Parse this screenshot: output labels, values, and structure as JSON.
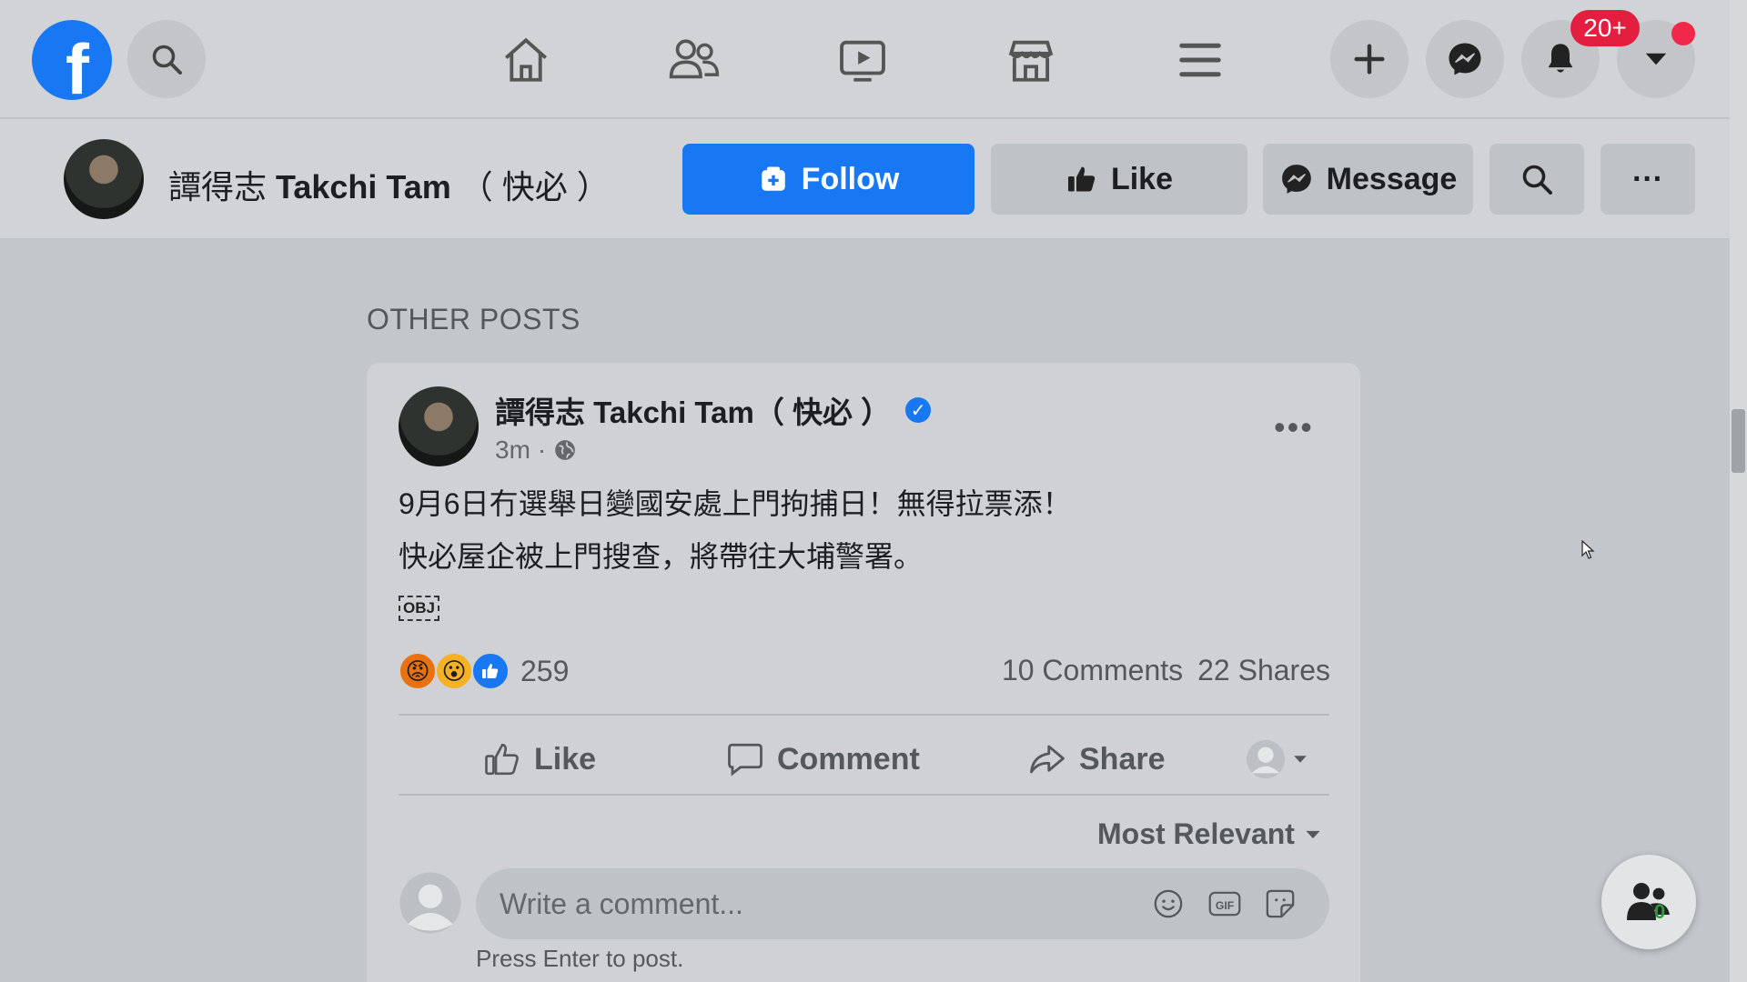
{
  "topnav": {
    "logo_letter": "f",
    "notification_badge": "20+"
  },
  "page_header": {
    "page_name_cjk": "譚得志",
    "page_name_latin": "Takchi Tam",
    "page_name_suffix": "（ 快必 ）",
    "follow_label": "Follow",
    "like_label": "Like",
    "message_label": "Message",
    "more_label": "···"
  },
  "section_title": "OTHER POSTS",
  "post": {
    "author": "譚得志 Takchi Tam（ 快必 ）",
    "time": "3m",
    "lines": [
      "9月6日冇選舉日變國安處上門拘捕日！無得拉票添！",
      "快必屋企被上門搜查，將帶往大埔警署。"
    ],
    "obj_label": "OBJ",
    "reaction_count": "259",
    "comments": "10 Comments",
    "shares": "22 Shares",
    "actions": {
      "like": "Like",
      "comment": "Comment",
      "share": "Share"
    },
    "sort_label": "Most Relevant",
    "comment_placeholder": "Write a comment...",
    "comment_hint": "Press Enter to post.",
    "gif_label": "GIF"
  },
  "contacts_float": {
    "count": "0"
  },
  "colors": {
    "brand_blue": "#1877f2",
    "badge_red": "#e41e3f",
    "online_green": "#2d9a3c"
  },
  "icons": [
    "facebook-logo",
    "search-icon",
    "home-icon",
    "friends-icon",
    "watch-icon",
    "marketplace-icon",
    "menu-icon",
    "plus-icon",
    "messenger-icon",
    "bell-icon",
    "caret-down-icon",
    "globe-icon",
    "verified-icon",
    "like-icon",
    "comment-icon",
    "share-icon",
    "emoji-icon",
    "gif-icon",
    "sticker-icon",
    "contacts-icon"
  ]
}
